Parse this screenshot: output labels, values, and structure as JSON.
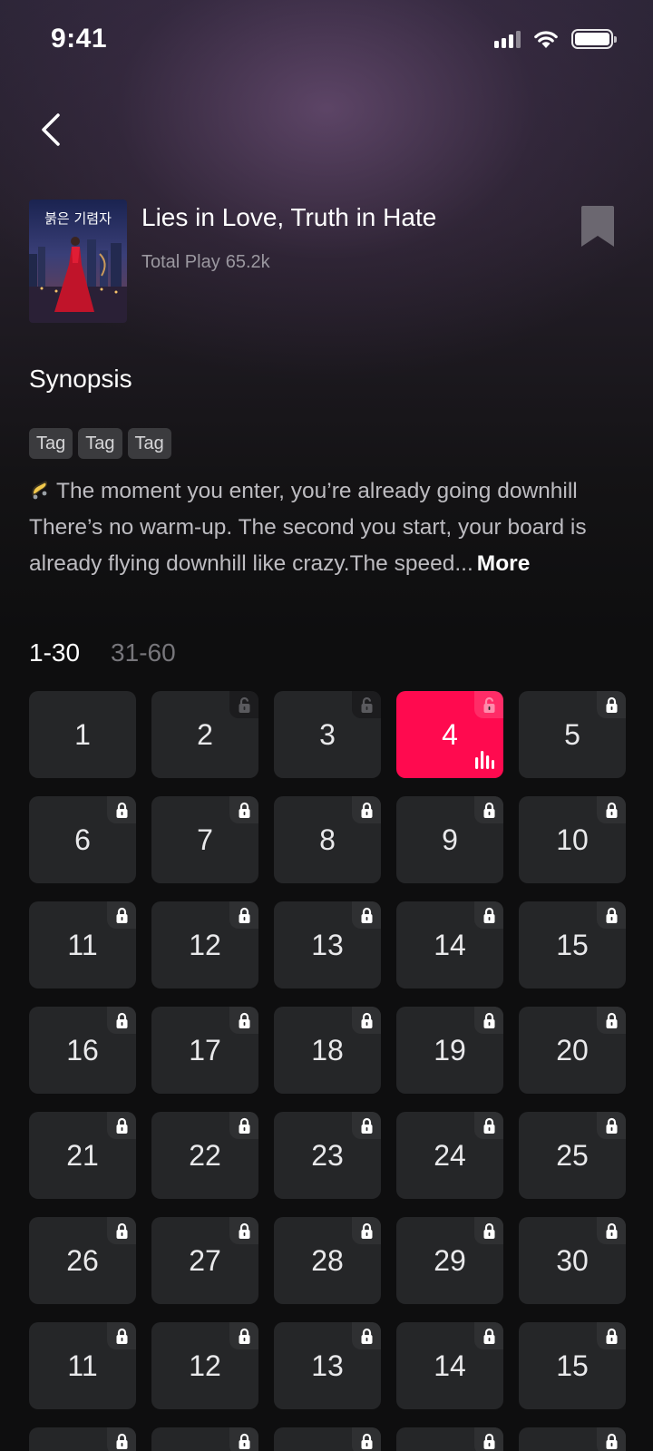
{
  "status_bar": {
    "time": "9:41"
  },
  "drama": {
    "title": "Lies in Love, Truth in Hate",
    "plays_label": "Total Play",
    "plays_value": "65.2k",
    "poster_title": "붉은 기렴자"
  },
  "synopsis": {
    "heading": "Synopsis",
    "tags": [
      "Tag",
      "Tag",
      "Tag"
    ],
    "text": "The moment you enter, you’re already going downhill There’s no warm-up. The second you start, your board is already flying downhill like crazy.The speed...",
    "more_label": "More"
  },
  "ranges": [
    {
      "label": "1-30",
      "active": true
    },
    {
      "label": "31-60",
      "active": false
    }
  ],
  "episodes": [
    {
      "number": "1",
      "lock": "none"
    },
    {
      "number": "2",
      "lock": "unlocked"
    },
    {
      "number": "3",
      "lock": "unlocked"
    },
    {
      "number": "4",
      "lock": "unlocked",
      "current": true
    },
    {
      "number": "5",
      "lock": "locked"
    },
    {
      "number": "6",
      "lock": "locked"
    },
    {
      "number": "7",
      "lock": "locked"
    },
    {
      "number": "8",
      "lock": "locked"
    },
    {
      "number": "9",
      "lock": "locked"
    },
    {
      "number": "10",
      "lock": "locked"
    },
    {
      "number": "11",
      "lock": "locked"
    },
    {
      "number": "12",
      "lock": "locked"
    },
    {
      "number": "13",
      "lock": "locked"
    },
    {
      "number": "14",
      "lock": "locked"
    },
    {
      "number": "15",
      "lock": "locked"
    },
    {
      "number": "16",
      "lock": "locked"
    },
    {
      "number": "17",
      "lock": "locked"
    },
    {
      "number": "18",
      "lock": "locked"
    },
    {
      "number": "19",
      "lock": "locked"
    },
    {
      "number": "20",
      "lock": "locked"
    },
    {
      "number": "21",
      "lock": "locked"
    },
    {
      "number": "22",
      "lock": "locked"
    },
    {
      "number": "23",
      "lock": "locked"
    },
    {
      "number": "24",
      "lock": "locked"
    },
    {
      "number": "25",
      "lock": "locked"
    },
    {
      "number": "26",
      "lock": "locked"
    },
    {
      "number": "27",
      "lock": "locked"
    },
    {
      "number": "28",
      "lock": "locked"
    },
    {
      "number": "29",
      "lock": "locked"
    },
    {
      "number": "30",
      "lock": "locked"
    },
    {
      "number": "11",
      "lock": "locked"
    },
    {
      "number": "12",
      "lock": "locked"
    },
    {
      "number": "13",
      "lock": "locked"
    },
    {
      "number": "14",
      "lock": "locked"
    },
    {
      "number": "15",
      "lock": "locked"
    },
    {
      "number": "",
      "lock": "locked"
    },
    {
      "number": "",
      "lock": "locked"
    },
    {
      "number": "",
      "lock": "locked"
    },
    {
      "number": "",
      "lock": "locked"
    },
    {
      "number": "",
      "lock": "locked"
    }
  ],
  "colors": {
    "accent": "#ff0a4f",
    "tile": "#252628",
    "background": "#0e0e0f"
  },
  "icons": {
    "back": "chevron-left-icon",
    "bookmark": "bookmark-icon",
    "locked": "lock-icon",
    "unlocked": "unlock-icon",
    "playing": "equalizer-icon",
    "synopsis_emoji": "skateboard-icon"
  }
}
